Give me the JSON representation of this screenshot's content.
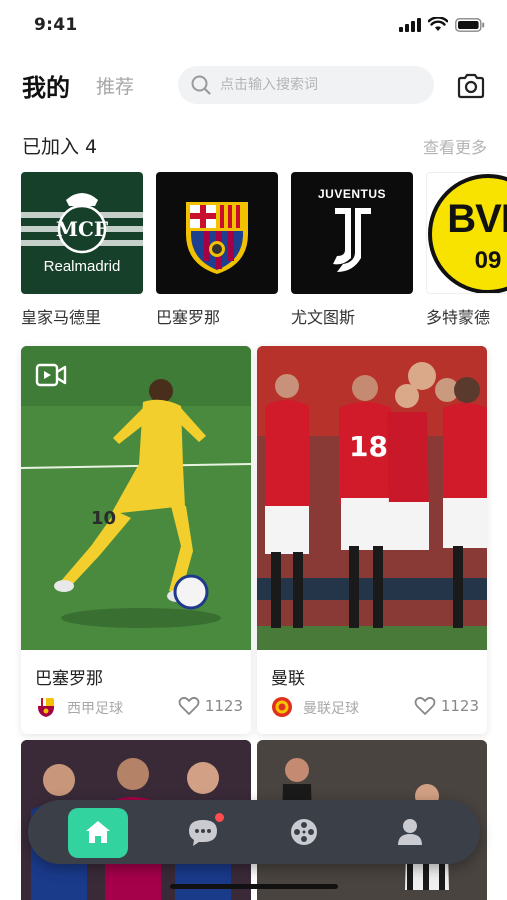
{
  "status_bar": {
    "time": "9:41"
  },
  "header": {
    "tab_mine": "我的",
    "tab_recommend": "推荐",
    "search_placeholder": "点击输入搜索词"
  },
  "joined": {
    "title": "已加入 4",
    "see_more": "查看更多",
    "teams": [
      {
        "name": "皇家马德里",
        "logo_text": "Realmadrid",
        "logo_bg": "#17402a"
      },
      {
        "name": "巴塞罗那",
        "logo_bg": "#0c0c0c"
      },
      {
        "name": "尤文图斯",
        "logo_text": "JUVENTUS",
        "logo_bg": "#0c0c0c"
      },
      {
        "name": "多特蒙德",
        "logo_text": "BVB",
        "logo_sub": "09",
        "logo_bg": "#f7e200"
      }
    ]
  },
  "feed": [
    {
      "title": "巴塞罗那",
      "club": "西甲足球",
      "likes": "1123",
      "has_video": true,
      "jersey_no": "10"
    },
    {
      "title": "曼联",
      "club": "曼联足球",
      "likes": "1123",
      "has_video": false,
      "jersey_no": "18"
    }
  ],
  "tabbar": {
    "items": [
      {
        "icon": "home-icon",
        "active": true
      },
      {
        "icon": "chat-icon",
        "badge": true
      },
      {
        "icon": "film-reel-icon"
      },
      {
        "icon": "profile-icon"
      }
    ]
  },
  "colors": {
    "accent": "#33d3a0",
    "tabbar_bg": "#3b3f48",
    "badge": "#ff4d4f"
  }
}
